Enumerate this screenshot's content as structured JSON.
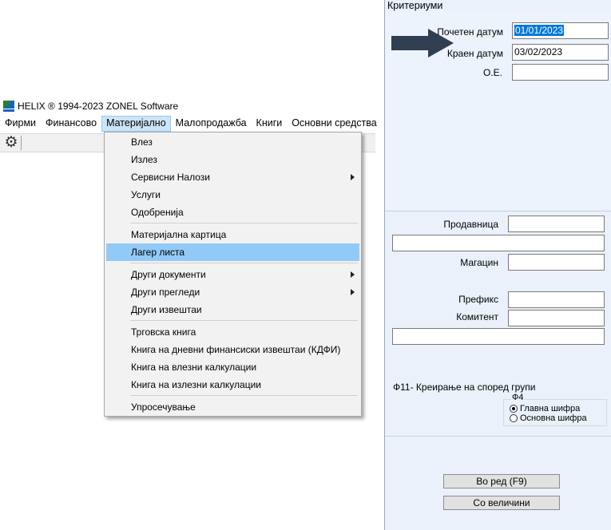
{
  "app": {
    "title": "HELIX ® 1994-2023  ZONEL Software",
    "menubar": [
      "Фирми",
      "Финансово",
      "Материјално",
      "Малопродажба",
      "Книги",
      "Основни средства"
    ],
    "active_menu": "Материјално"
  },
  "dropdown": {
    "items": [
      {
        "label": "Влез"
      },
      {
        "label": "Излез"
      },
      {
        "label": "Сервисни Налози",
        "submenu": true
      },
      {
        "label": "Услуги"
      },
      {
        "label": "Одобренија"
      },
      {
        "label": "Материјална картица"
      },
      {
        "label": "Лагер листа",
        "highlighted": true
      },
      {
        "label": "Други документи",
        "submenu": true
      },
      {
        "label": "Други прегледи",
        "submenu": true
      },
      {
        "label": "Други извештаи"
      },
      {
        "label": "Трговска книга"
      },
      {
        "label": "Книга на дневни финансиски извештаи (КДФИ)"
      },
      {
        "label": "Книга на влезни калкулации"
      },
      {
        "label": "Книга на излезни калкулации"
      },
      {
        "label": "Упросечување"
      }
    ]
  },
  "criteria": {
    "title": "Критериуми",
    "start_date_label": "Почетен датум",
    "start_date_value": "01/01/2023",
    "end_date_label": "Краен датум",
    "end_date_value": "03/02/2023",
    "oe_label": "О.Е.",
    "oe_value": "",
    "store_label": "Продавница",
    "warehouse_label": "Магацин",
    "prefix_label": "Префикс",
    "client_label": "Комитент",
    "f11_text": "Ф11- Креирање на  според групи",
    "f4_label": "Ф4",
    "radio_main": "Главна шифра",
    "radio_basic": "Основна шифра",
    "radio_selected": "Главна шифра",
    "button_order": "Во ред  (F9)",
    "button_amounts": "Со величини",
    "arrow_color": "#2f3e50"
  }
}
